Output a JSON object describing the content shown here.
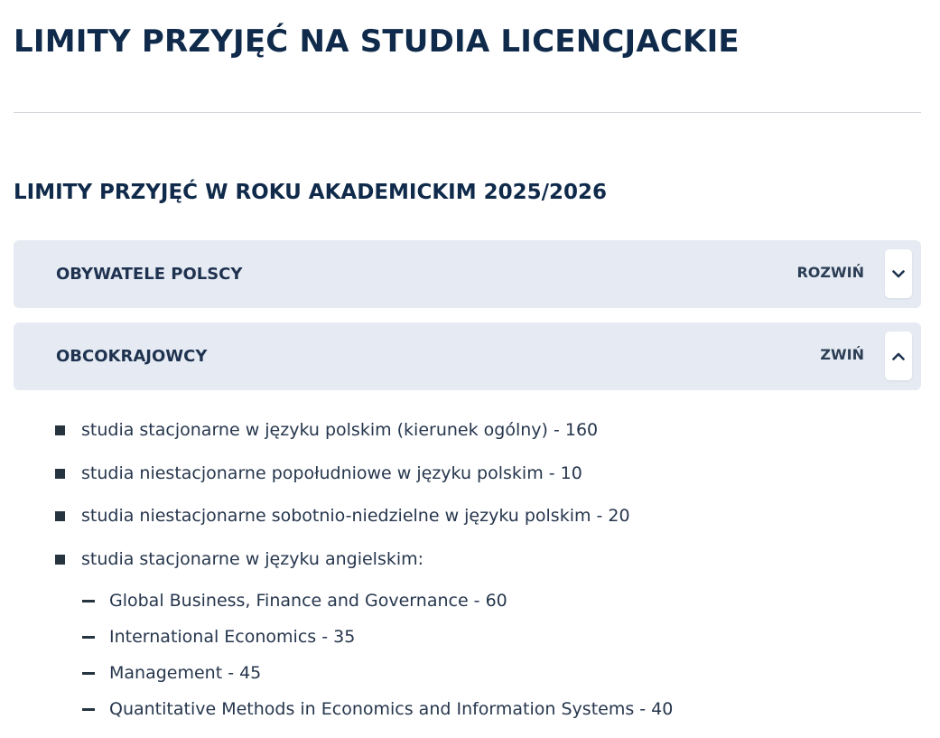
{
  "page": {
    "title": "LIMITY PRZYJĘĆ NA STUDIA LICENCJACKIE",
    "section_heading": "LIMITY PRZYJĘĆ W ROKU AKADEMICKIM 2025/2026"
  },
  "accordions": [
    {
      "title": "OBYWATELE POLSCY",
      "toggle_label": "ROZWIŃ",
      "expanded": false,
      "icon": "chevron-down-icon"
    },
    {
      "title": "OBCOKRAJOWCY",
      "toggle_label": "ZWIŃ",
      "expanded": true,
      "icon": "chevron-up-icon"
    }
  ],
  "limits_list": [
    "studia stacjonarne w języku polskim (kierunek ogólny) - 160",
    "studia niestacjonarne popołudniowe w języku polskim - 10",
    "studia niestacjonarne sobotnio-niedzielne w języku polskim - 20",
    "studia stacjonarne w języku angielskim:"
  ],
  "english_programs": [
    "Global Business, Finance and Governance - 60",
    "International Economics - 35",
    "Management - 45",
    "Quantitative Methods in Economics and Information Systems - 40"
  ],
  "colors": {
    "heading": "#0f2a4a",
    "accordion_bg": "#e6ebf3",
    "text": "#26364d",
    "bullet": "#26343f"
  }
}
